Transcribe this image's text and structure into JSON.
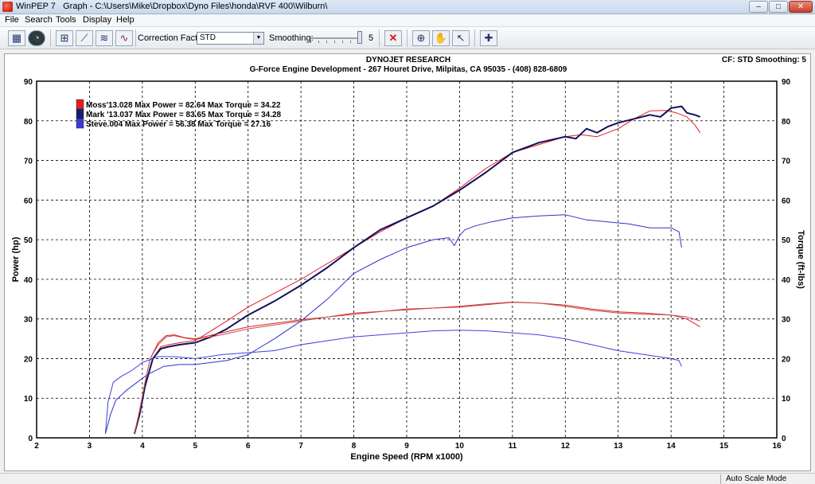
{
  "window": {
    "app_name": "WinPEP 7",
    "title": "Graph - C:\\Users\\Mike\\Dropbox\\Dyno Files\\honda\\RVF 400\\Wilburn\\",
    "minimize": "–",
    "maximize": "□",
    "close": "✕"
  },
  "menu": [
    "File",
    "Search",
    "Tools",
    "Display",
    "Help"
  ],
  "toolbar": {
    "correction_factor_label": "Correction Factor:",
    "correction_factor_value": "STD",
    "smoothing_label": "Smoothing:",
    "smoothing_value": "5",
    "icons": [
      "grid-icon",
      "gauge-icon",
      "graph-add-icon",
      "graph-icon",
      "graph-compare-icon",
      "graph-wave-icon",
      "delete-run-icon",
      "zoom-icon",
      "pan-hand-icon",
      "cursor-select-icon",
      "crosshair-icon"
    ]
  },
  "graph": {
    "header": "DYNOJET RESEARCH",
    "subheader": "G-Force Engine Development - 267 Houret Drive, Milpitas, CA 95035 - (408) 828-6809",
    "cf_readout": "CF: STD  Smoothing: 5"
  },
  "chart_data": {
    "type": "line",
    "xlabel": "Engine Speed (RPM x1000)",
    "ylabel": "Power (hp)",
    "y2label": "Torque (ft-lbs)",
    "xlim": [
      2,
      16
    ],
    "ylim": [
      0,
      90
    ],
    "y2lim": [
      0,
      90
    ],
    "xticks": [
      2,
      3,
      4,
      5,
      6,
      7,
      8,
      9,
      10,
      11,
      12,
      13,
      14,
      15,
      16
    ],
    "yticks": [
      0,
      10,
      20,
      30,
      40,
      50,
      60,
      70,
      80,
      90
    ],
    "grid": true,
    "legend_position": "top-left",
    "legend": [
      {
        "label": "Moss'13.028 Max Power = 82.64 Max Torque = 34.22",
        "color": "#e02020"
      },
      {
        "label": "Mark '13.037 Max Power = 83.65 Max Torque = 34.28",
        "color": "#1a1a70"
      },
      {
        "label": "Steve.004 Max Power = 56.38 Max Torque = 27.16",
        "color": "#3a3ad8"
      }
    ],
    "series": [
      {
        "run": "Moss'13.028",
        "kind": "power",
        "color": "#e02020",
        "width": 1,
        "x": [
          3.85,
          3.95,
          4.05,
          4.2,
          4.35,
          4.5,
          4.7,
          5.0,
          5.3,
          5.6,
          6.0,
          6.5,
          7.0,
          7.5,
          8.0,
          8.5,
          9.0,
          9.5,
          10.0,
          10.5,
          11.0,
          11.5,
          12.0,
          12.3,
          12.6,
          13.0,
          13.3,
          13.6,
          13.9,
          14.1,
          14.3,
          14.45,
          14.55
        ],
        "y": [
          1,
          6,
          13,
          20,
          23,
          23.5,
          24,
          24.5,
          27,
          29.5,
          33,
          36.5,
          40,
          44,
          48,
          52,
          55.5,
          58.5,
          63,
          68,
          72,
          74,
          76,
          76.5,
          76,
          78,
          80.5,
          82.5,
          82.6,
          82,
          81,
          79,
          77
        ]
      },
      {
        "run": "Mark '13.037",
        "kind": "power",
        "color": "#10105c",
        "width": 2,
        "x": [
          3.85,
          3.95,
          4.05,
          4.2,
          4.35,
          4.5,
          4.7,
          5.0,
          5.3,
          5.6,
          6.0,
          6.5,
          7.0,
          7.5,
          8.0,
          8.5,
          9.0,
          9.5,
          10.0,
          10.5,
          11.0,
          11.5,
          12.0,
          12.2,
          12.4,
          12.6,
          12.8,
          13.0,
          13.3,
          13.6,
          13.8,
          14.0,
          14.2,
          14.3,
          14.45,
          14.55
        ],
        "y": [
          1,
          6,
          13,
          20,
          22.5,
          23,
          23.5,
          24,
          25.5,
          27.5,
          31,
          34.5,
          38.5,
          43,
          48,
          52.5,
          55.5,
          58.5,
          62.5,
          67,
          72,
          74.5,
          76,
          75.5,
          78,
          77,
          78.5,
          79.5,
          80.5,
          81.5,
          81,
          83.2,
          83.65,
          82,
          81.5,
          81
        ]
      },
      {
        "run": "Steve.004",
        "kind": "power",
        "color": "#3030c8",
        "width": 1,
        "x": [
          3.3,
          3.4,
          3.5,
          3.7,
          3.9,
          4.1,
          4.4,
          4.7,
          5.0,
          5.3,
          5.6,
          6.0,
          6.5,
          7.0,
          7.5,
          8.0,
          8.5,
          9.0,
          9.5,
          9.8,
          9.9,
          10.0,
          10.1,
          10.3,
          10.6,
          11.0,
          11.5,
          12.0,
          12.4,
          12.8,
          13.2,
          13.6,
          14.0,
          14.15,
          14.2
        ],
        "y": [
          1,
          6,
          9.5,
          12,
          14,
          16,
          18,
          18.5,
          18.5,
          19,
          19.5,
          21,
          25,
          29.5,
          35,
          41.5,
          45,
          48,
          50,
          50.5,
          48.5,
          51,
          52.5,
          53.5,
          54.5,
          55.5,
          56,
          56.3,
          55,
          54.5,
          54,
          53,
          53,
          52,
          48
        ]
      },
      {
        "run": "Moss'13.028",
        "kind": "torque",
        "color": "#e02020",
        "width": 1,
        "x": [
          3.85,
          3.95,
          4.05,
          4.15,
          4.3,
          4.45,
          4.6,
          4.8,
          5.0,
          5.5,
          6.0,
          7.0,
          8.0,
          9.0,
          10.0,
          10.5,
          11.0,
          11.5,
          12.0,
          12.5,
          13.0,
          13.5,
          14.0,
          14.3,
          14.55
        ],
        "y": [
          1,
          7,
          14,
          20,
          24,
          25.8,
          26,
          25.3,
          25,
          26.5,
          28,
          29.8,
          31.2,
          32.5,
          33,
          33.6,
          34.2,
          34,
          33.5,
          32.5,
          31.8,
          31.5,
          31,
          30,
          28
        ]
      },
      {
        "run": "Mark '13.037",
        "kind": "torque",
        "color": "#c05050",
        "width": 1,
        "x": [
          3.85,
          3.95,
          4.05,
          4.15,
          4.3,
          4.45,
          4.6,
          4.8,
          5.0,
          5.5,
          6.0,
          7.0,
          8.0,
          9.0,
          10.0,
          10.5,
          11.0,
          11.5,
          12.0,
          12.5,
          13.0,
          13.5,
          14.0,
          14.3,
          14.55
        ],
        "y": [
          1,
          7,
          14,
          20,
          23.5,
          25.5,
          25.8,
          25.2,
          24.8,
          26,
          27.5,
          29.5,
          31.5,
          32.3,
          33.2,
          33.8,
          34.28,
          34,
          33.2,
          32.2,
          31.5,
          31.2,
          31,
          30.5,
          29.5
        ]
      },
      {
        "run": "Steve.004",
        "kind": "torque",
        "color": "#4040e0",
        "width": 1,
        "x": [
          3.3,
          3.35,
          3.45,
          3.6,
          3.8,
          4.0,
          4.3,
          4.6,
          5.0,
          5.5,
          6.0,
          6.5,
          7.0,
          7.5,
          8.0,
          8.5,
          9.0,
          9.5,
          10.0,
          10.5,
          11.0,
          11.5,
          12.0,
          12.5,
          13.0,
          13.5,
          14.0,
          14.15,
          14.2
        ],
        "y": [
          1,
          9,
          14,
          15.5,
          17,
          19,
          20.5,
          20.5,
          20,
          21,
          21.5,
          22,
          23.5,
          24.5,
          25.5,
          26,
          26.5,
          27,
          27.16,
          27,
          26.5,
          26,
          25,
          23.5,
          22,
          21,
          20,
          19.5,
          18
        ]
      }
    ]
  },
  "statusbar": {
    "mode": "Auto Scale Mode"
  }
}
